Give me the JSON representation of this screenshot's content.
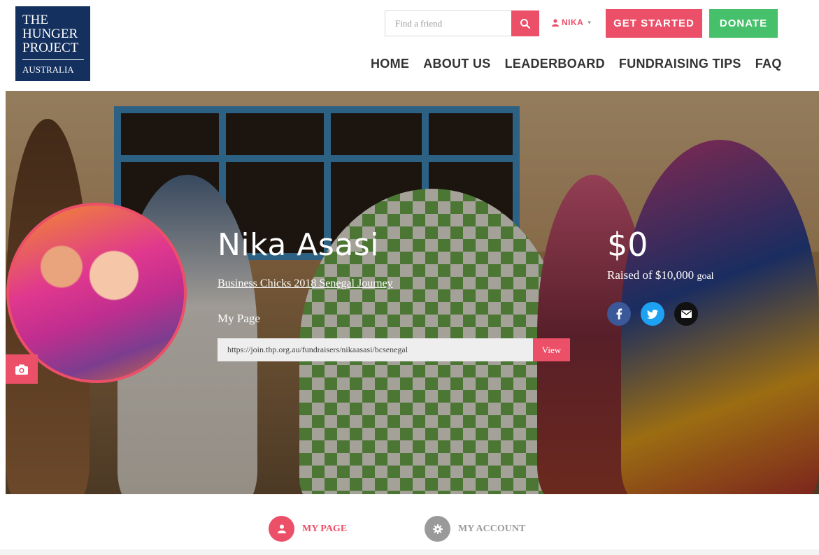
{
  "logo": {
    "line1": "THE",
    "line2": "HUNGER",
    "line3": "PROJECT",
    "line4": "AUSTRALIA"
  },
  "header": {
    "search_placeholder": "Find a friend",
    "user_name": "NIKA",
    "get_started_label": "GET STARTED",
    "donate_label": "DONATE"
  },
  "nav": {
    "items": [
      {
        "label": "HOME"
      },
      {
        "label": "ABOUT US"
      },
      {
        "label": "LEADERBOARD"
      },
      {
        "label": "FUNDRAISING TIPS"
      },
      {
        "label": "FAQ"
      }
    ]
  },
  "profile": {
    "name": "Nika Asasi",
    "campaign": "Business Chicks 2018 Senegal Journey",
    "my_page_label": "My Page",
    "page_url": "https://join.thp.org.au/fundraisers/nikaasasi/bcsenegal",
    "view_label": "View",
    "amount_raised": "$0",
    "goal_prefix": "Raised of $10,000",
    "goal_suffix": "goal"
  },
  "tabs": {
    "my_page": "MY PAGE",
    "my_account": "MY ACCOUNT"
  },
  "colors": {
    "accent": "#ec4f68",
    "donate": "#46c06a",
    "logo_bg": "#14305e",
    "facebook": "#3b5998",
    "twitter": "#1da1f2",
    "email": "#111111",
    "inactive_tab": "#9a9a9a"
  },
  "icons": {
    "search": "search-icon",
    "user": "user-icon",
    "camera": "camera-icon",
    "facebook": "facebook-icon",
    "twitter": "twitter-icon",
    "email": "envelope-icon",
    "gear": "gear-icon"
  }
}
